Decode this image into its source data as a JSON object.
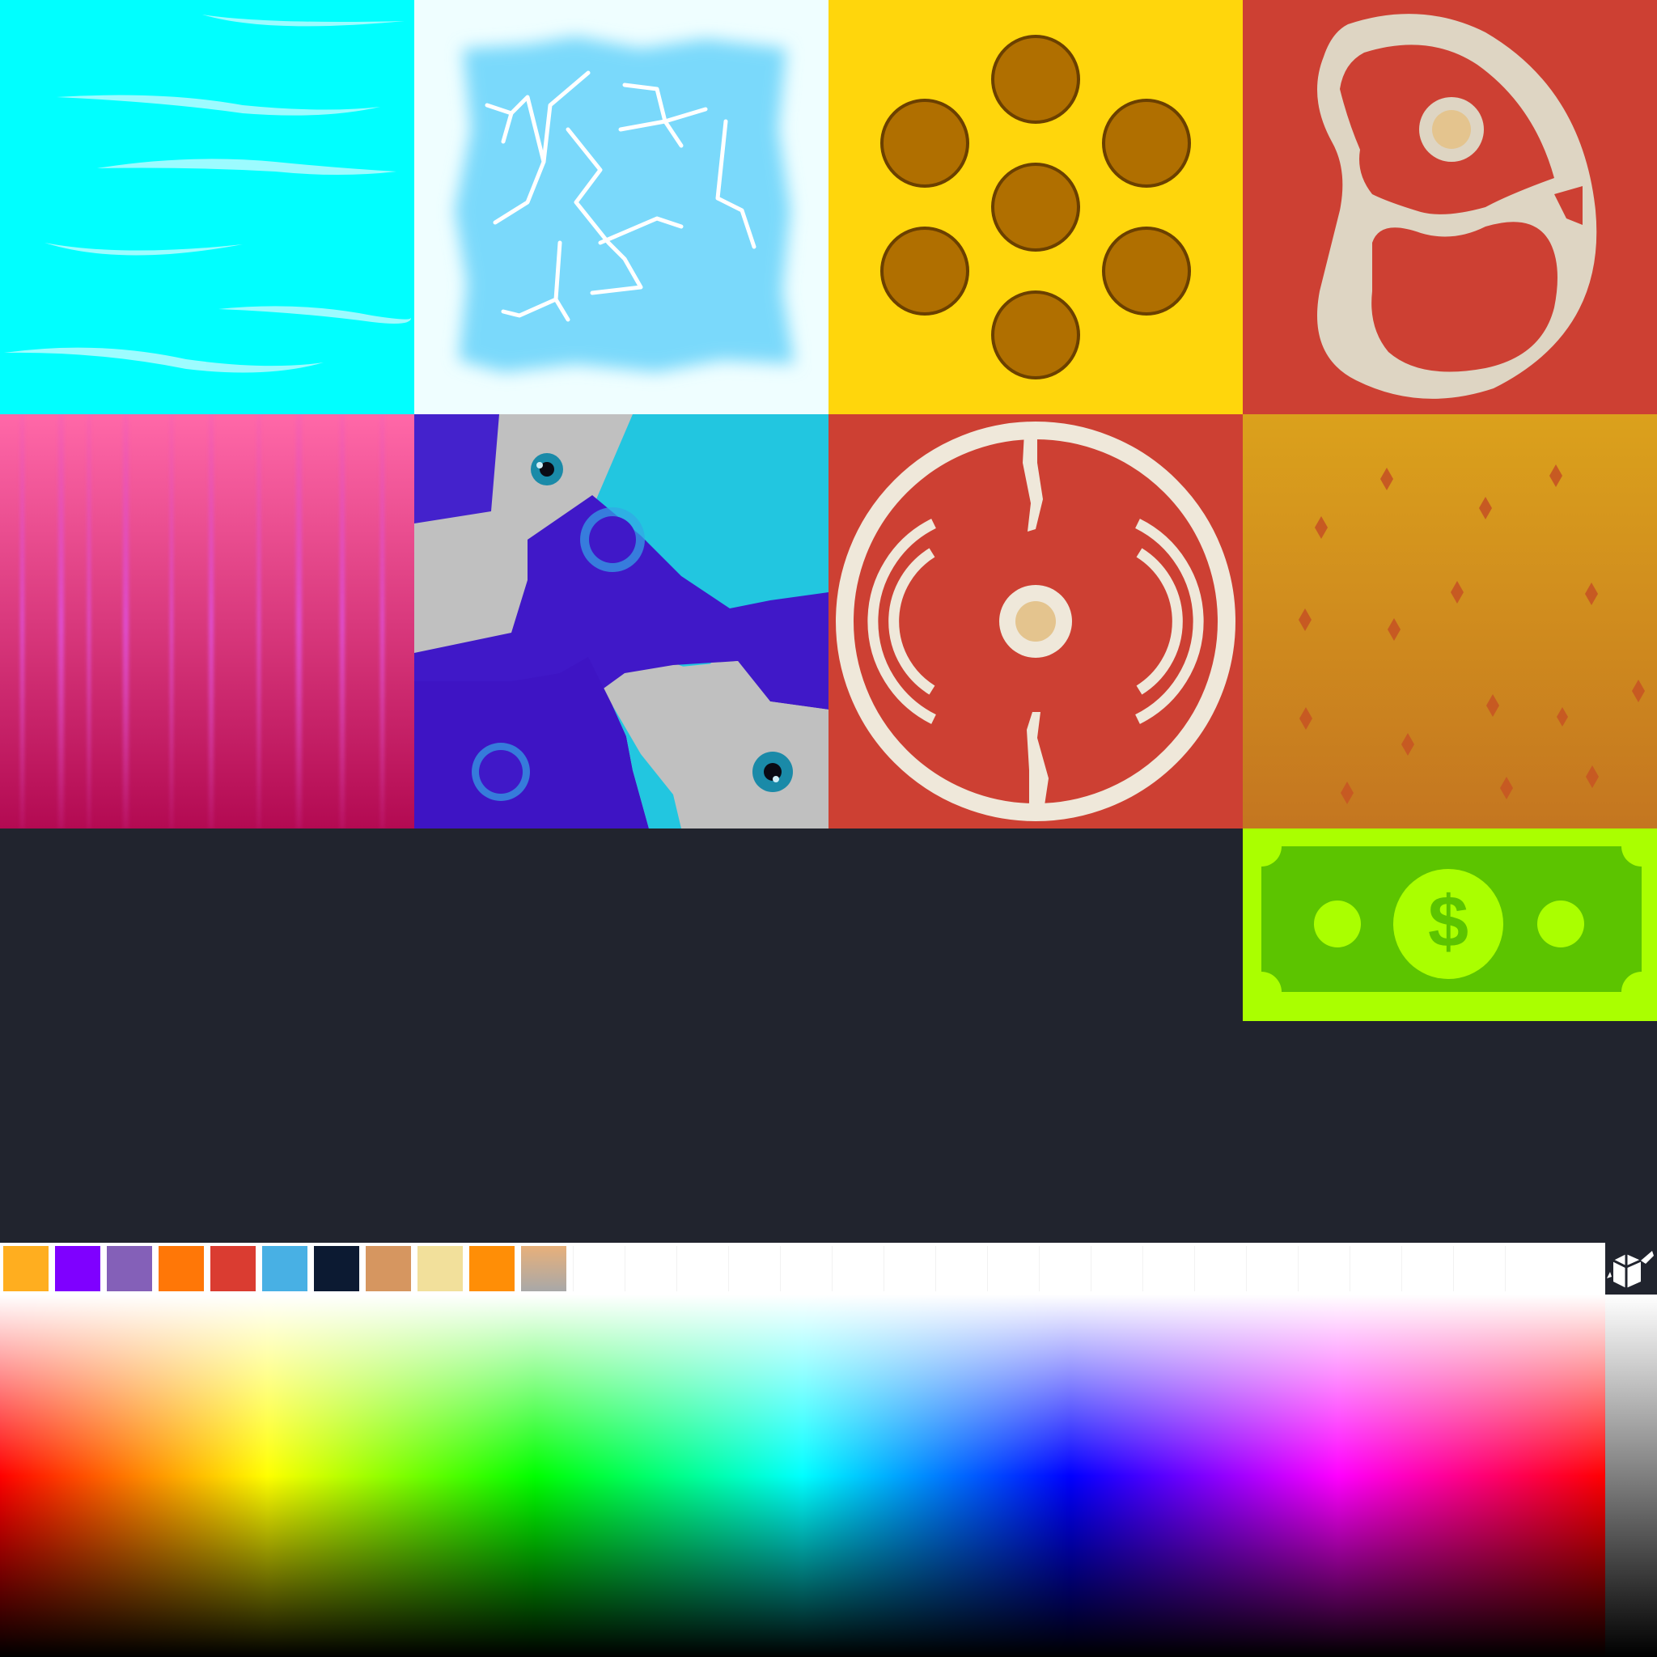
{
  "textures": [
    {
      "name": "water",
      "bg": "#00ffff"
    },
    {
      "name": "ice",
      "bg": "#effeff"
    },
    {
      "name": "cookie",
      "bg": "#ffd60c"
    },
    {
      "name": "steak",
      "bg": "#cd4033"
    },
    {
      "name": "curtain",
      "bg": "#e85090"
    },
    {
      "name": "slime",
      "bg": "#c0c0c0"
    },
    {
      "name": "salami",
      "bg": "#cd4033"
    },
    {
      "name": "bread",
      "bg": "#d6981b"
    },
    {
      "name": "money",
      "bg": "#aaff00"
    }
  ],
  "palette": {
    "swatches": [
      "#ffae1f",
      "#7f00ff",
      "#8460b8",
      "#ff7707",
      "#da3c31",
      "#48b0e4",
      "#0c1a32",
      "#d69660",
      "#f2e09b",
      "#ff8e06",
      "#caa895"
    ],
    "empty_slots": 19
  },
  "icons": {
    "logo": "paint-bucket-logo-icon"
  }
}
